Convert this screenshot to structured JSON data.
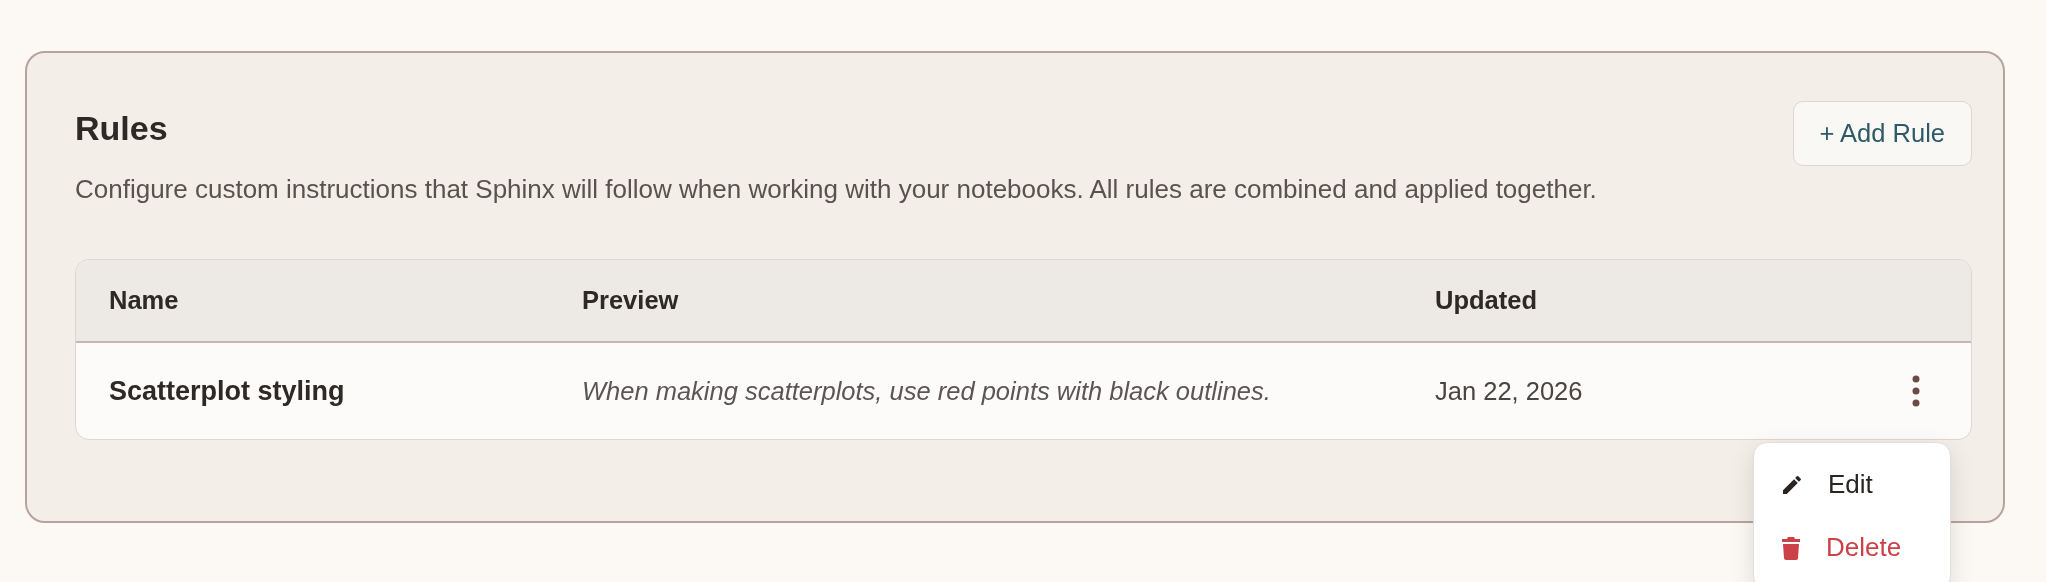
{
  "header": {
    "title": "Rules",
    "description": "Configure custom instructions that Sphinx will follow when working with your notebooks. All rules are combined and applied together.",
    "add_button": "+ Add Rule"
  },
  "table": {
    "columns": [
      "Name",
      "Preview",
      "Updated"
    ],
    "rows": [
      {
        "name": "Scatterplot styling",
        "preview": "When making scatterplots, use red points with black outlines.",
        "updated": "Jan 22, 2026"
      }
    ]
  },
  "menu": [
    {
      "kind": "edit",
      "label": "Edit"
    },
    {
      "kind": "delete",
      "label": "Delete"
    }
  ]
}
